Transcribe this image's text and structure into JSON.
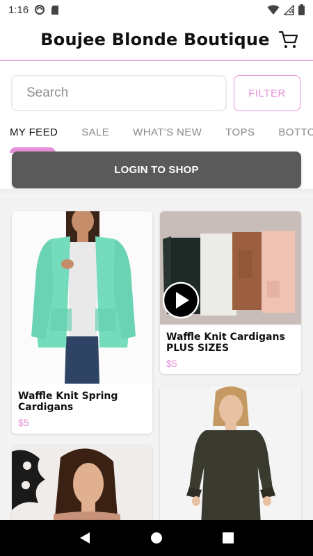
{
  "status_bar": {
    "time": "1:16"
  },
  "header": {
    "title": "Boujee Blonde Boutique",
    "cart_icon": "cart-icon"
  },
  "search": {
    "placeholder": "Search",
    "filter_label": "FILTER"
  },
  "tabs": [
    {
      "label": "MY FEED",
      "active": true
    },
    {
      "label": "SALE"
    },
    {
      "label": "WHAT'S NEW"
    },
    {
      "label": "TOPS"
    },
    {
      "label": "BOTTOMS"
    }
  ],
  "login": {
    "label": "LOGIN TO SHOP"
  },
  "products": [
    {
      "title": "Waffle Knit Spring Cardigans",
      "price": "$5"
    },
    {
      "title": "Waffle Knit Cardigans PLUS SIZES",
      "price": "$5",
      "has_video": true
    },
    {
      "title": "",
      "price": ""
    },
    {
      "title": "",
      "price": ""
    }
  ],
  "colors": {
    "accent": "#e58fd6",
    "login_bg": "#5a5a5a"
  }
}
